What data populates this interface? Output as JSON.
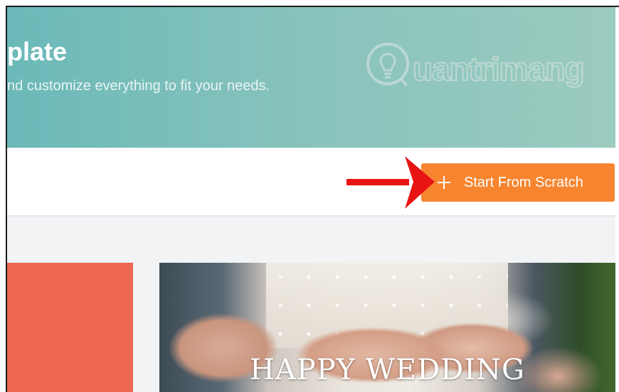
{
  "hero": {
    "title": "plate",
    "subtitle": "nd customize everything to fit your needs.",
    "watermark_text": "uantrimang"
  },
  "toolbar": {
    "start_button_label": "Start From Scratch",
    "start_button_icon": "plus-icon"
  },
  "gallery": {
    "cards": [
      {
        "color": "#ec6652"
      },
      {
        "title": "HAPPY WEDDING"
      }
    ]
  },
  "colors": {
    "accent": "#f7852f",
    "hero_gradient_start": "#6bb9b9",
    "hero_gradient_end": "#9ccbbf",
    "arrow": "#e81313"
  }
}
